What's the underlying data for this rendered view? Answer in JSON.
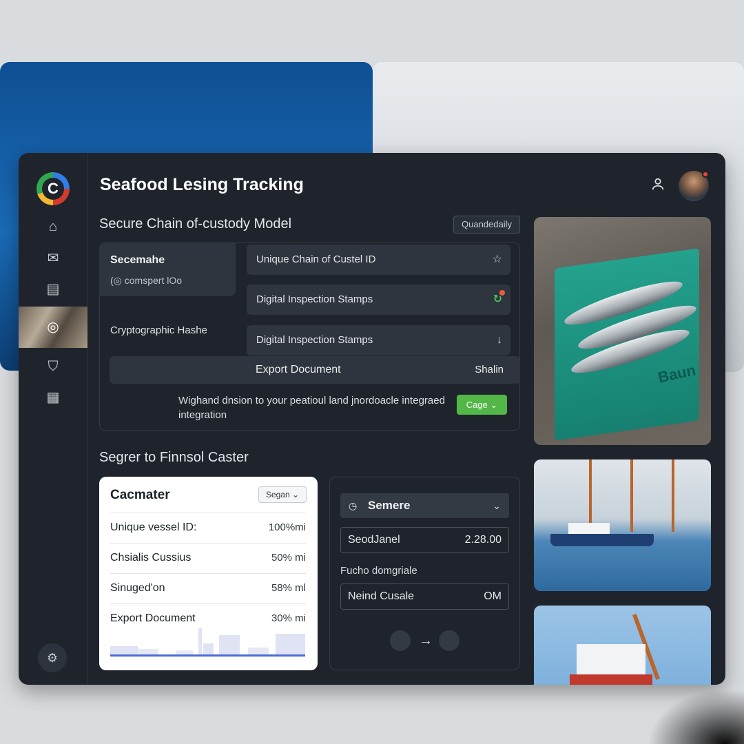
{
  "app": {
    "title": "Seafood Lesing Tracking"
  },
  "sidebar": {
    "logo_letter": "C",
    "items": [
      {
        "icon": "home-icon",
        "glyph": "⌂"
      },
      {
        "icon": "mail-check-icon",
        "glyph": "✉"
      },
      {
        "icon": "document-icon",
        "glyph": "▤"
      },
      {
        "icon": "fish-icon",
        "glyph": "◎"
      },
      {
        "icon": "shield-icon",
        "glyph": "⛉"
      },
      {
        "icon": "clipboard-icon",
        "glyph": "▦"
      }
    ],
    "bottom_icon": "settings-icon"
  },
  "header": {
    "user_icon": "user-icon",
    "avatar": "avatar"
  },
  "custody": {
    "title": "Secure Chain of-custody Model",
    "chip": "Quandedaily",
    "security_card": {
      "title": "Secemahe",
      "subtitle": "(◎ comspert lOo"
    },
    "crypto_label": "Cryptographic Hashe",
    "features": [
      {
        "label": "Unique Chain of Custel ID",
        "icon": "star-icon",
        "glyph": "☆"
      },
      {
        "label": "Digital Inspection Stamps",
        "icon": "refresh-icon",
        "glyph": "↻"
      },
      {
        "label": "Digital Inspection Stamps",
        "icon": "download-icon",
        "glyph": "↓"
      }
    ],
    "export": {
      "label": "Export Document",
      "right": "Shalin"
    },
    "integration_text": "Wighand dnsion to your peatioul land jnordoacle integraed integration",
    "cta": "Cage ⌄"
  },
  "segment": {
    "title": "Segrer to Finnsol Caster",
    "table": {
      "title": "Cacmater",
      "select": "Segan ⌄",
      "rows": [
        {
          "label": "Unique vessel ID:",
          "value": "100%mi"
        },
        {
          "label": "Chsialis Cussius",
          "value": "50% mi"
        },
        {
          "label": "Sinuged'on",
          "value": "58% ml"
        },
        {
          "label": "Export Document",
          "value": "30% mi"
        }
      ]
    },
    "form": {
      "dropdown": "Semere",
      "field1": {
        "label": "SeodJanel",
        "value": "2.28.00"
      },
      "label2": "Fucho domgriale",
      "field2": {
        "label": "Neind Cusale",
        "value": "OM"
      }
    }
  },
  "photos": {
    "crate_text": "Baun"
  }
}
